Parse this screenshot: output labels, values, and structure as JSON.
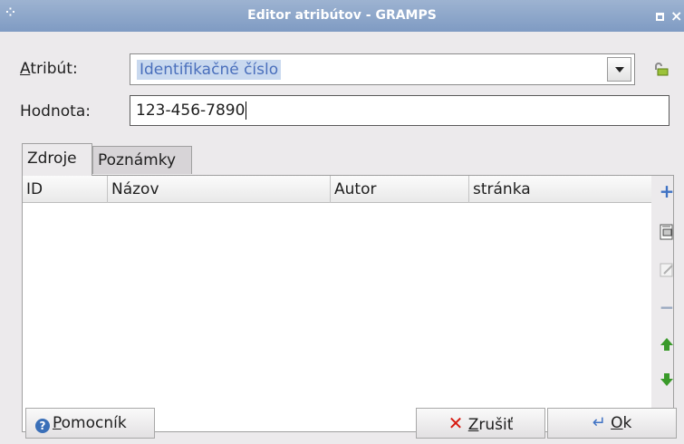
{
  "window": {
    "title": "Editor atribútov - GRAMPS"
  },
  "form": {
    "attribute_label": "Atribút:",
    "attribute_mnemonic": "A",
    "attribute_rest": "tribút:",
    "attribute_value": "Identifikačné číslo",
    "value_label": "Hodnota:",
    "value_value": "123-456-7890"
  },
  "tabs": [
    {
      "label": "Zdroje",
      "active": true
    },
    {
      "label": "Poznámky",
      "active": false
    }
  ],
  "table": {
    "columns": [
      "ID",
      "Názov",
      "Autor",
      "stránka"
    ],
    "rows": []
  },
  "side_toolbar": [
    {
      "icon": "add-icon"
    },
    {
      "icon": "share-existing-icon"
    },
    {
      "icon": "edit-icon"
    },
    {
      "icon": "remove-icon"
    },
    {
      "icon": "move-up-icon"
    },
    {
      "icon": "move-down-icon"
    }
  ],
  "buttons": {
    "help_label": "Pomocník",
    "help_mnemonic": "P",
    "help_rest": "omocník",
    "cancel_label": "Zrušiť",
    "cancel_mnemonic": "Z",
    "cancel_rest": "rušiť",
    "ok_label": "Ok",
    "ok_mnemonic": "O",
    "ok_rest": "k"
  },
  "colors": {
    "titlebar": "#8aa5cb",
    "selection": "#c9d9ef",
    "cancel_icon": "#d71a10",
    "ok_icon": "#3f72c4",
    "arrow_green": "#3a9a2a"
  }
}
